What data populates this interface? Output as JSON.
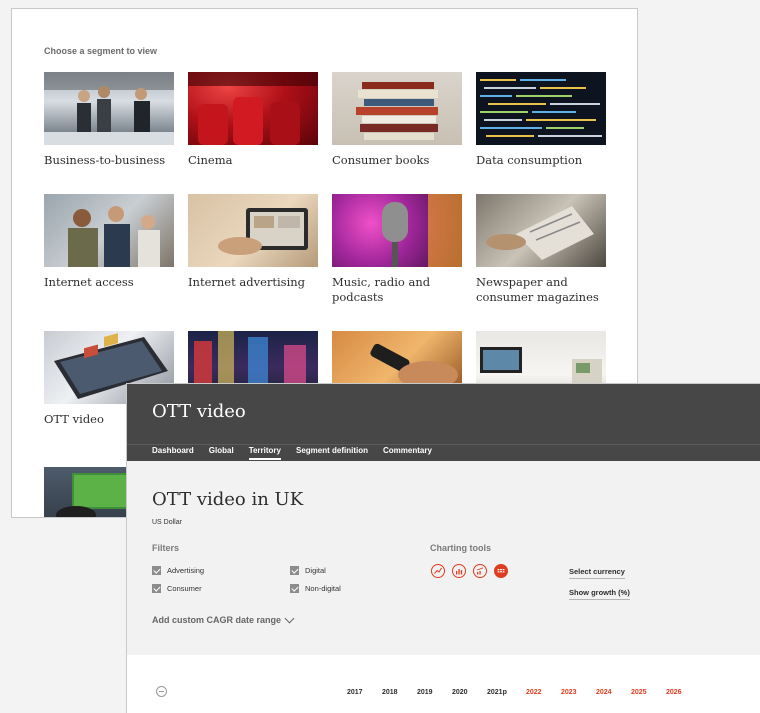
{
  "segments_panel": {
    "heading": "Choose a segment to view",
    "tiles": [
      {
        "label": "Business-to-business"
      },
      {
        "label": "Cinema"
      },
      {
        "label": "Consumer books"
      },
      {
        "label": "Data consumption"
      },
      {
        "label": "Internet access"
      },
      {
        "label": "Internet advertising"
      },
      {
        "label": "Music, radio and podcasts"
      },
      {
        "label": "Newspaper and consumer magazines"
      },
      {
        "label": "OTT video"
      }
    ]
  },
  "ott_panel": {
    "header_title": "OTT video",
    "tabs": [
      {
        "label": "Dashboard"
      },
      {
        "label": "Global"
      },
      {
        "label": "Territory"
      },
      {
        "label": "Segment definition"
      },
      {
        "label": "Commentary"
      }
    ],
    "active_tab": "Territory",
    "page_title": "OTT video in UK",
    "currency": "US Dollar",
    "filters_title": "Filters",
    "filters": [
      {
        "label": "Advertising",
        "checked": true
      },
      {
        "label": "Digital",
        "checked": true
      },
      {
        "label": "Consumer",
        "checked": true
      },
      {
        "label": "Non-digital",
        "checked": true
      }
    ],
    "charting_title": "Charting tools",
    "charting_tools": [
      {
        "icon": "line-chart-icon"
      },
      {
        "icon": "bar-chart-icon"
      },
      {
        "icon": "combo-chart-icon"
      },
      {
        "icon": "table-icon",
        "selected": true
      }
    ],
    "select_currency": "Select currency",
    "show_growth": "Show growth (%)",
    "cagr_label": "Add custom CAGR date range",
    "years": [
      "2017",
      "2018",
      "2019",
      "2020",
      "2021p",
      "2022",
      "2023",
      "2024",
      "2025",
      "2026"
    ],
    "accent_color": "#e03c1f",
    "header_color": "#474747"
  }
}
